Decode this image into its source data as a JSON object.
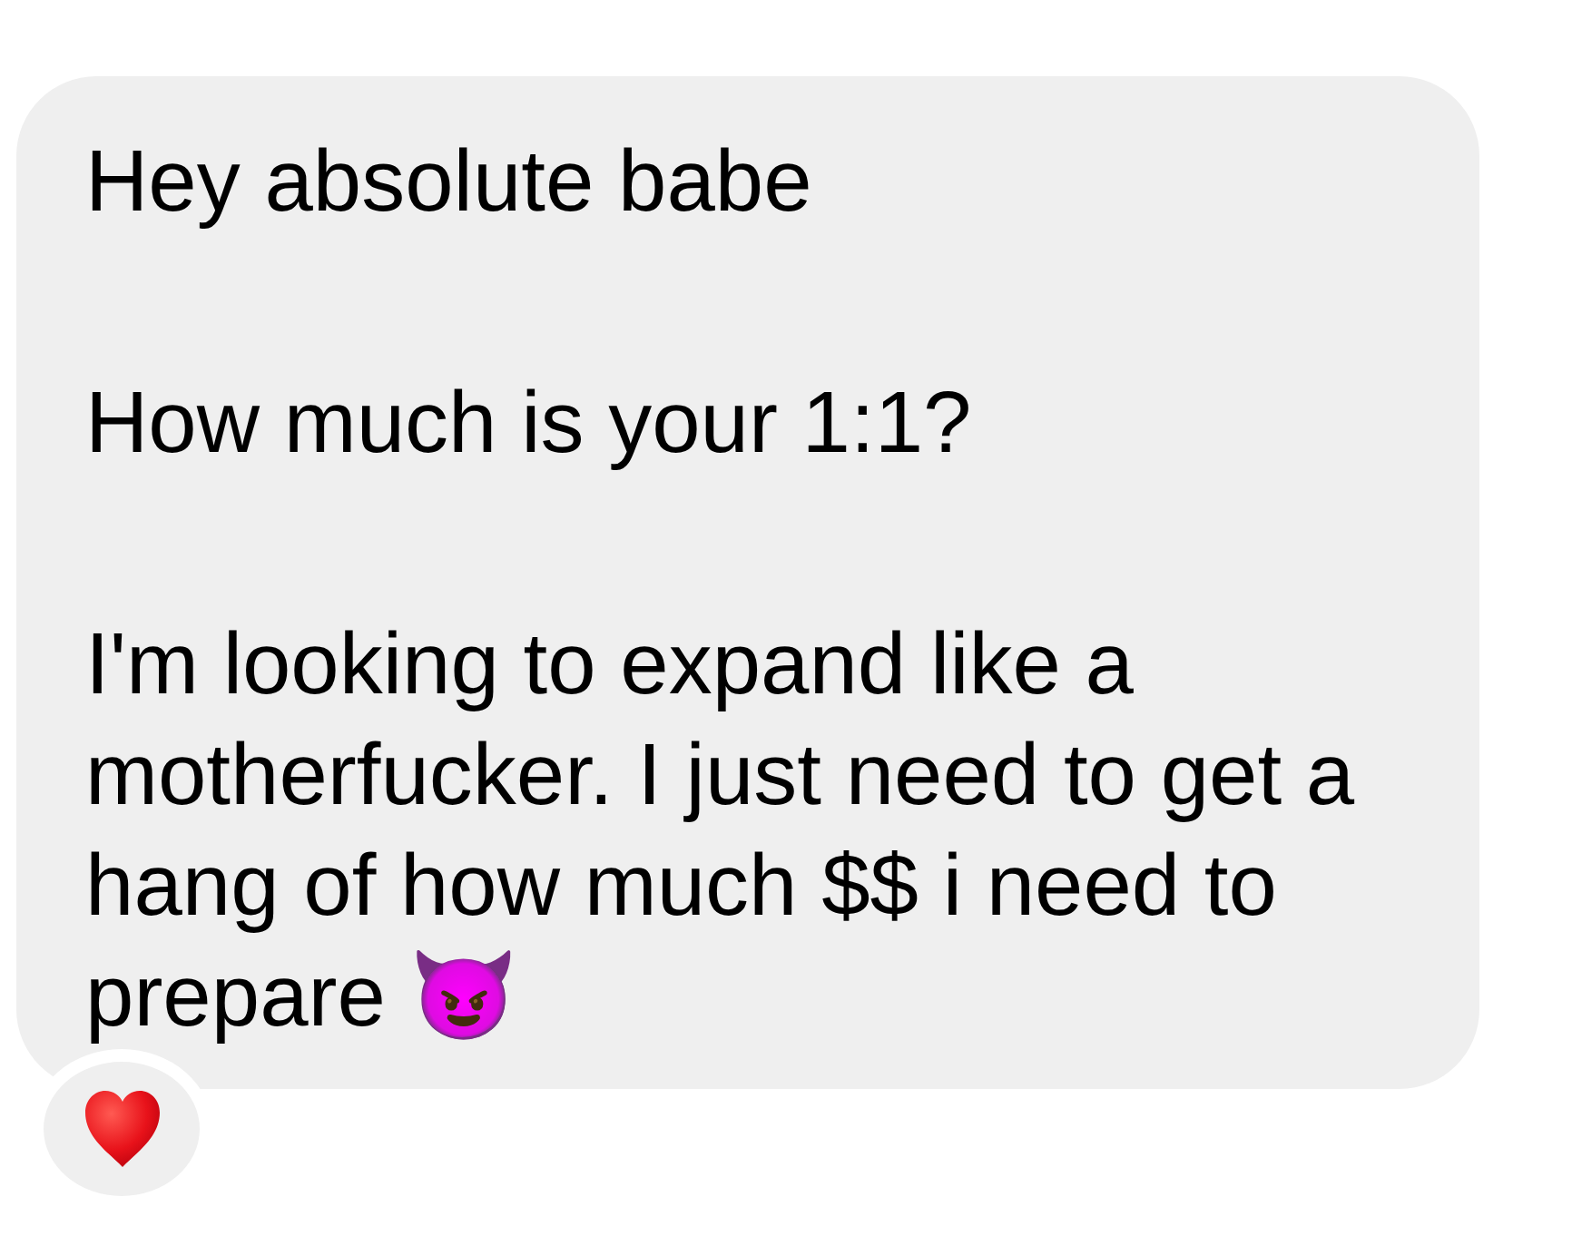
{
  "message": {
    "paragraphs": [
      "Hey absolute babe",
      "How much is your 1:1?",
      "I'm looking to expand like a motherfucker. I just need to get a hang of how much $$ i need to prepare 😈"
    ]
  }
}
